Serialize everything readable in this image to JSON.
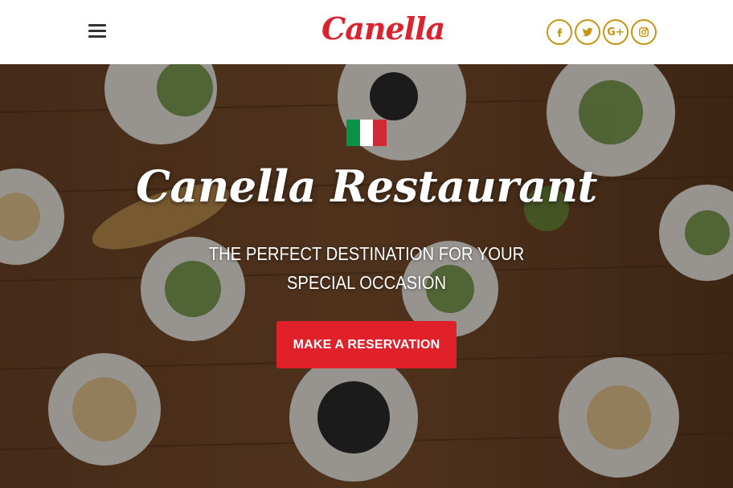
{
  "header": {
    "logo_text": "Canella",
    "socials": [
      {
        "name": "facebook",
        "icon": "facebook-icon"
      },
      {
        "name": "twitter",
        "icon": "twitter-icon"
      },
      {
        "name": "google-plus",
        "icon": "google-plus-icon",
        "glyph": "G+"
      },
      {
        "name": "instagram",
        "icon": "instagram-icon"
      }
    ]
  },
  "hero": {
    "title": "Canella Restaurant",
    "subtitle": "THE PERFECT DESTINATION FOR YOUR SPECIAL OCCASION",
    "cta_label": "MAKE A RESERVATION",
    "flag_colors": [
      "#0b9246",
      "#ffffff",
      "#ce2b37"
    ]
  },
  "colors": {
    "brand_red": "#d9232e",
    "social_gold": "#c79514",
    "button_red": "#e0212a"
  }
}
